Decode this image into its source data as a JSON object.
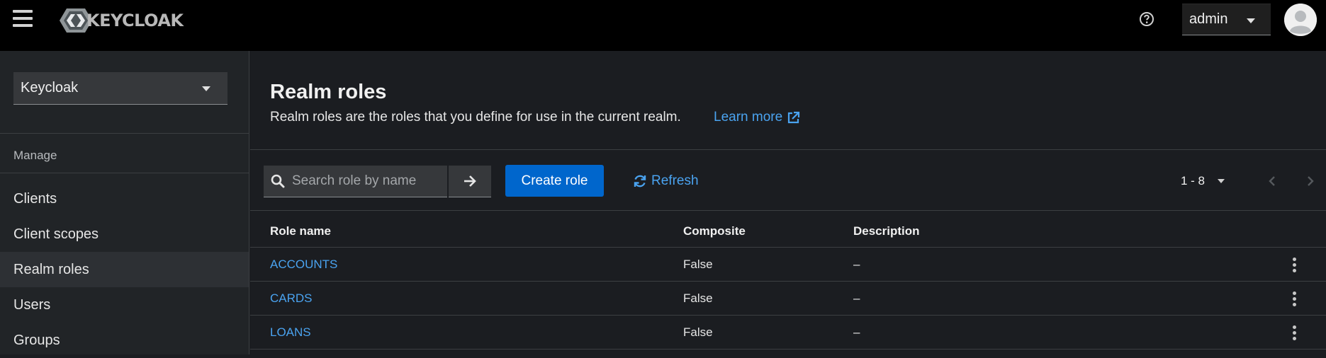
{
  "header": {
    "brand": "KEYCLOAK",
    "user_menu_label": "admin",
    "icons": {
      "menu": "hamburger-icon",
      "help": "help-circle-icon",
      "avatar": "user-avatar-icon"
    }
  },
  "sidebar": {
    "realm": "Keycloak",
    "section_title": "Manage",
    "items": [
      {
        "label": "Clients",
        "active": false
      },
      {
        "label": "Client scopes",
        "active": false
      },
      {
        "label": "Realm roles",
        "active": true
      },
      {
        "label": "Users",
        "active": false
      },
      {
        "label": "Groups",
        "active": false
      }
    ]
  },
  "page": {
    "title": "Realm roles",
    "description": "Realm roles are the roles that you define for use in the current realm.",
    "learn_more": "Learn more"
  },
  "toolbar": {
    "search_placeholder": "Search role by name",
    "create_label": "Create role",
    "refresh_label": "Refresh",
    "pagination_range": "1 - 8"
  },
  "table": {
    "columns": [
      "Role name",
      "Composite",
      "Description"
    ],
    "rows": [
      {
        "name": "ACCOUNTS",
        "composite": "False",
        "description": "–"
      },
      {
        "name": "CARDS",
        "composite": "False",
        "description": "–"
      },
      {
        "name": "LOANS",
        "composite": "False",
        "description": "–"
      }
    ]
  },
  "colors": {
    "accent": "#0066cc",
    "link": "#4aa3f0",
    "header_bg": "#000000",
    "sidebar_bg": "#212427",
    "main_bg": "#1b1d21"
  }
}
